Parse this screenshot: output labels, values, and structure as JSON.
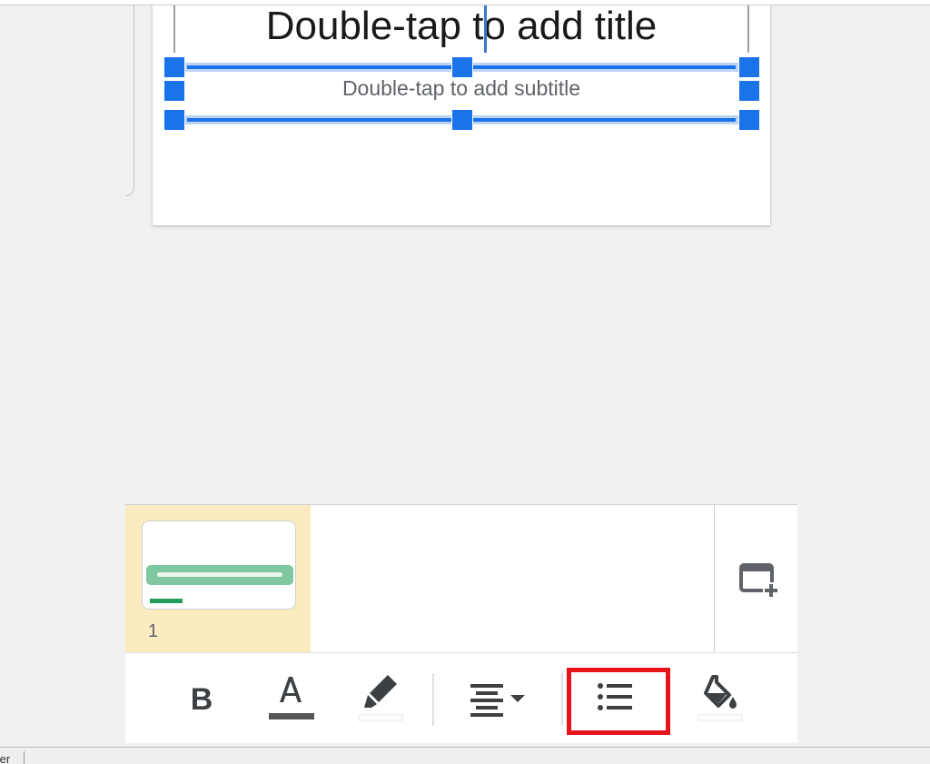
{
  "slide": {
    "title_placeholder": "Double-tap to add title",
    "subtitle_placeholder": "Double-tap to add subtitle"
  },
  "filmstrip": {
    "slides": [
      {
        "number": "1",
        "selected": true
      }
    ],
    "add_slide_icon": "add-slide-icon"
  },
  "toolbar": {
    "bold_label": "B",
    "items": [
      "bold",
      "text-color",
      "highlight",
      "align",
      "bulleted-list",
      "fill-color"
    ],
    "highlighted_item": "bulleted-list"
  },
  "statusbar": {
    "text": "ter"
  },
  "colors": {
    "accent": "#1a73e8",
    "selected_thumb_bg": "#fbebc1",
    "highlight_border": "#e8141b",
    "thumb_green": "#1e9e5a"
  }
}
